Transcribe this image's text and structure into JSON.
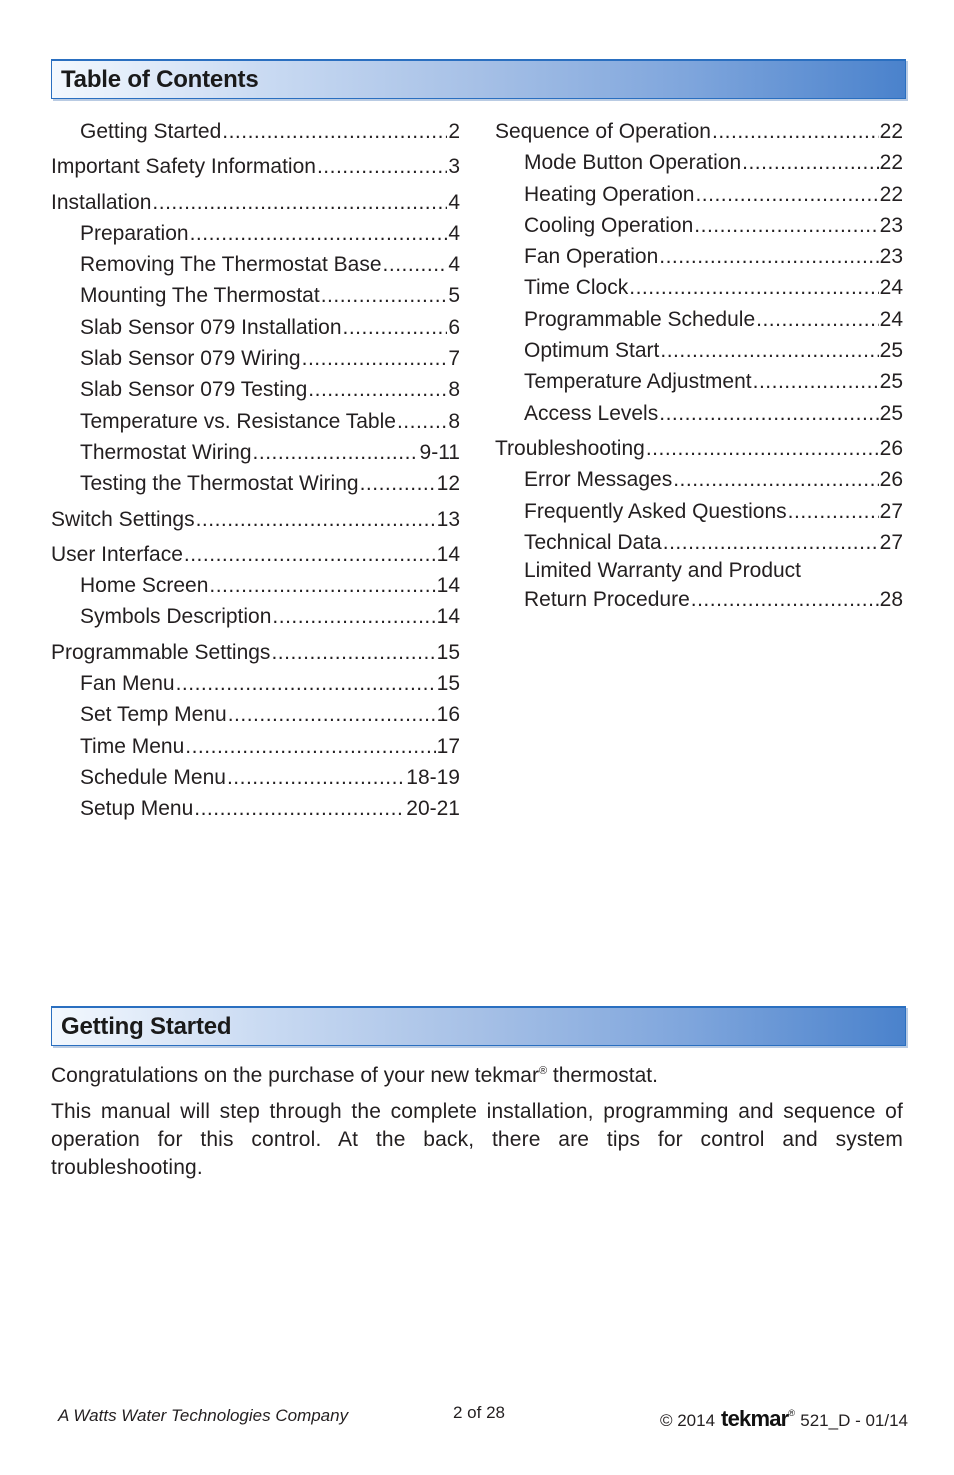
{
  "toc": {
    "title": "Table of Contents",
    "left_column": [
      {
        "entries": [
          {
            "title": "Getting Started",
            "page": "2",
            "level": 2
          }
        ]
      },
      {
        "entries": [
          {
            "title": "Important Safety Information",
            "page": "3",
            "level": 1
          }
        ]
      },
      {
        "entries": [
          {
            "title": "Installation",
            "page": "4",
            "level": 1
          },
          {
            "title": "Preparation",
            "page": "4",
            "level": 2
          },
          {
            "title": "Removing The Thermostat Base",
            "page": "4",
            "level": 2
          },
          {
            "title": "Mounting The Thermostat",
            "page": "5",
            "level": 2
          },
          {
            "title": "Slab Sensor 079 Installation",
            "page": "6",
            "level": 2
          },
          {
            "title": "Slab Sensor 079 Wiring",
            "page": "7",
            "level": 2
          },
          {
            "title": "Slab Sensor 079 Testing",
            "page": "8",
            "level": 2
          },
          {
            "title": "Temperature vs. Resistance Table",
            "page": "8",
            "level": 2
          },
          {
            "title": "Thermostat Wiring",
            "page": "9-11",
            "level": 2
          },
          {
            "title": "Testing the Thermostat Wiring",
            "page": "12",
            "level": 2
          }
        ]
      },
      {
        "entries": [
          {
            "title": "Switch Settings",
            "page": "13",
            "level": 1
          }
        ]
      },
      {
        "entries": [
          {
            "title": "User Interface",
            "page": "14",
            "level": 1
          },
          {
            "title": "Home Screen",
            "page": "14",
            "level": 2
          },
          {
            "title": "Symbols Description",
            "page": "14",
            "level": 2
          }
        ]
      },
      {
        "entries": [
          {
            "title": "Programmable Settings",
            "page": "15",
            "level": 1
          },
          {
            "title": "Fan Menu",
            "page": "15",
            "level": 2
          },
          {
            "title": "Set Temp Menu",
            "page": "16",
            "level": 2
          },
          {
            "title": "Time Menu",
            "page": "17",
            "level": 2
          },
          {
            "title": "Schedule Menu",
            "page": "18-19",
            "level": 2
          },
          {
            "title": "Setup Menu",
            "page": "20-21",
            "level": 2
          }
        ]
      }
    ],
    "right_column": [
      {
        "entries": [
          {
            "title": "Sequence of Operation",
            "page": "22",
            "level": 1
          },
          {
            "title": "Mode Button Operation",
            "page": "22",
            "level": 2
          },
          {
            "title": "Heating Operation",
            "page": "22",
            "level": 2
          },
          {
            "title": "Cooling Operation",
            "page": "23",
            "level": 2
          },
          {
            "title": "Fan Operation",
            "page": "23",
            "level": 2
          },
          {
            "title": "Time Clock",
            "page": "24",
            "level": 2
          },
          {
            "title": "Programmable Schedule",
            "page": "24",
            "level": 2
          },
          {
            "title": "Optimum Start",
            "page": "25",
            "level": 2
          },
          {
            "title": "Temperature Adjustment",
            "page": "25",
            "level": 2
          },
          {
            "title": "Access Levels",
            "page": "25",
            "level": 2
          }
        ]
      },
      {
        "entries": [
          {
            "title": "Troubleshooting",
            "page": "26",
            "level": 1
          },
          {
            "title": "Error Messages",
            "page": "26",
            "level": 2
          },
          {
            "title": "Frequently Asked Questions",
            "page": "27",
            "level": 2
          },
          {
            "title": "Technical Data",
            "page": "27",
            "level": 2
          },
          {
            "title": "Limited Warranty and Product",
            "title_line2": "Return Procedure",
            "page": "28",
            "level": 2
          }
        ]
      }
    ]
  },
  "getting_started": {
    "title": "Getting Started",
    "intro_before_brand": "Congratulations on the purchase of your new tekmar",
    "intro_reg_mark": "®",
    "intro_after_brand": " thermostat.",
    "paragraph": "This manual will step through the complete installation, programming and sequence of operation for this control. At the back, there are tips for control and system troubleshooting."
  },
  "footer": {
    "company": "A Watts Water Technologies Company",
    "page_indicator": "2 of 28",
    "copyright": "© 2014",
    "brand": "tekmar",
    "brand_reg_mark": "®",
    "doc_code": "521_D - 01/14"
  },
  "colors": {
    "header_gradient_start": "#f3f8fe",
    "header_gradient_end": "#4a82cc",
    "header_border": "#2a6fc0",
    "text": "#231f20"
  }
}
